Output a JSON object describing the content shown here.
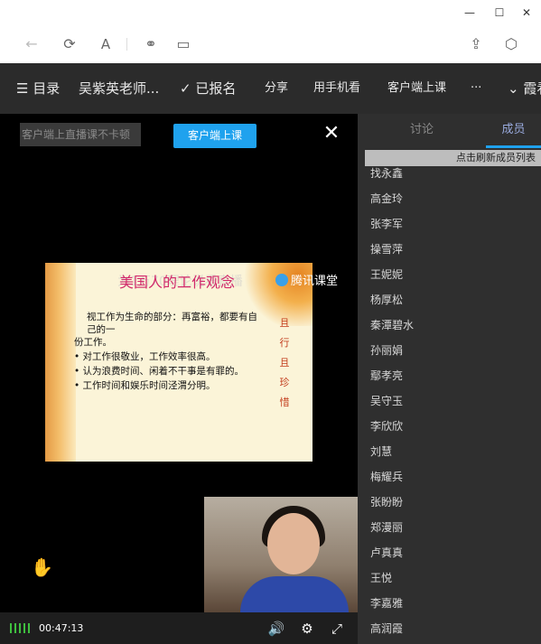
{
  "browser": {
    "win_min": "—",
    "win_max": "☐",
    "win_close": "✕"
  },
  "nav": {
    "catalog": "目录",
    "teacher": "吴紫英老师...",
    "enrolled": "已报名",
    "share": "分享",
    "mobile": "用手机看",
    "client_class": "客户端上课",
    "more": "···",
    "user": "霞看"
  },
  "video": {
    "tip": "客户端上直播课不卡顿",
    "client_button": "客户端上课",
    "close": "✕",
    "brand": "腾讯课堂",
    "time": "00:47:13"
  },
  "slide": {
    "title": "美国人的工作观念",
    "watermark": "为1万70理论说看直播",
    "line1": "视工作为生命的部分：再富裕，都要有自",
    "line2": "己的一",
    "line3": "份工作。",
    "line4": "对工作很敬业，工作效率很高。",
    "line5": "认为浪费时间、闲着不干事是有罪的。",
    "line6": "工作时间和娱乐时间泾渭分明。",
    "vertical": [
      "且",
      "行",
      "且",
      "珍",
      "惜"
    ]
  },
  "sidebar": {
    "tab_discuss": "讨论",
    "tab_members": "成员",
    "refresh": "点击刷新成员列表",
    "members": [
      "找永鑫",
      "高金玲",
      "张李军",
      "操雪萍",
      "王妮妮",
      "杨厚松",
      "秦潭碧水",
      "孙丽娟",
      "鄢孝亮",
      "吴守玉",
      "李欣欣",
      "刘慧",
      "梅耀兵",
      "张盼盼",
      "郑漫丽",
      "卢真真",
      "王悦",
      "李嘉雅",
      "高润霞"
    ]
  }
}
